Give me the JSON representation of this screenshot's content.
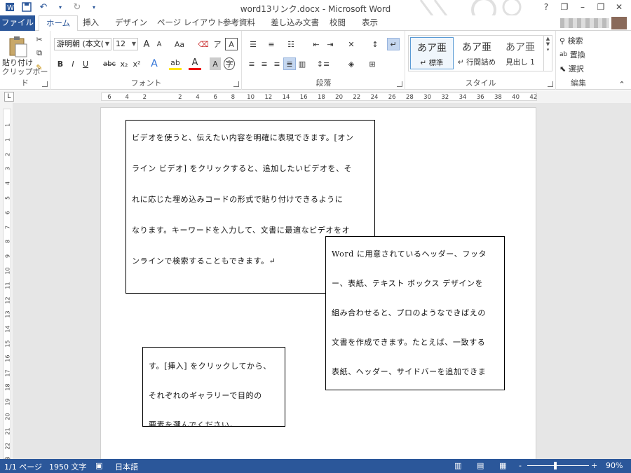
{
  "window": {
    "title": "word13リンク.docx - Microsoft Word",
    "help": "?",
    "restore": "❐",
    "minimize": "–",
    "maximize": "❐",
    "close": "✕"
  },
  "qat": {
    "save_icon": "save-icon",
    "undo_icon": "undo-icon",
    "redo_icon": "redo-icon"
  },
  "tabs": [
    {
      "label": "ファイル"
    },
    {
      "label": "ホーム"
    },
    {
      "label": "挿入"
    },
    {
      "label": "デザイン"
    },
    {
      "label": "ページ レイアウト"
    },
    {
      "label": "参考資料"
    },
    {
      "label": "差し込み文書"
    },
    {
      "label": "校閲"
    },
    {
      "label": "表示"
    }
  ],
  "ribbon": {
    "clipboard": {
      "label": "クリップボード",
      "paste": "貼り付け"
    },
    "font": {
      "label": "フォント",
      "font_name": "游明朝 (本文(",
      "font_size": "12",
      "grow": "A",
      "shrink": "A",
      "case": "Aa",
      "bold": "B",
      "italic": "I",
      "underline": "U",
      "strike": "abc",
      "sub": "x₂",
      "sup": "x²"
    },
    "paragraph": {
      "label": "段落"
    },
    "styles": {
      "label": "スタイル",
      "items": [
        {
          "sample": "あア亜",
          "name": "↵ 標準"
        },
        {
          "sample": "あア亜",
          "name": "↵ 行間詰め"
        },
        {
          "sample": "あア亜",
          "name": "見出し 1"
        }
      ]
    },
    "editing": {
      "label": "編集",
      "find": "検索",
      "replace": "置換",
      "select": "選択"
    }
  },
  "ruler": {
    "h_ticks": [
      "6",
      "4",
      "2",
      "",
      "2",
      "4",
      "6",
      "8",
      "10",
      "12",
      "14",
      "16",
      "18",
      "20",
      "22",
      "24",
      "26",
      "28",
      "30",
      "32",
      "34",
      "36",
      "38",
      "40",
      "42"
    ],
    "v_ticks": [
      "1",
      "1",
      "2",
      "3",
      "4",
      "5",
      "6",
      "7",
      "8",
      "9",
      "10",
      "11",
      "12",
      "13",
      "14",
      "15",
      "16",
      "17",
      "18",
      "19",
      "20",
      "21",
      "22",
      "23"
    ]
  },
  "document": {
    "box1": [
      "ビデオを使うと、伝えたい内容を明確に表現できます。[オン",
      "ライン ビデオ] をクリックすると、追加したいビデオを、そ",
      "れに応じた埋め込みコードの形式で貼り付けできるように",
      "なります。キーワードを入力して、文書に最適なビデオをオ",
      "ンラインで検索することもできます。↵"
    ],
    "box2": [
      "Word に用意されているヘッダー、フッタ",
      "ー、表紙、テキスト ボックス デザインを",
      "組み合わせると、プロのようなできばえの",
      "文書を作成できます。たとえば、一致する",
      "表紙、ヘッダー、サイドバーを追加できま"
    ],
    "box3": [
      "す。[挿入] をクリックしてから、",
      "それぞれのギャラリーで目的の",
      "要素を選んでください。"
    ]
  },
  "status": {
    "page": "1/1 ページ",
    "words": "1950 文字",
    "lang": "日本語",
    "zoom": "90%",
    "zoom_minus": "-",
    "zoom_plus": "+"
  }
}
